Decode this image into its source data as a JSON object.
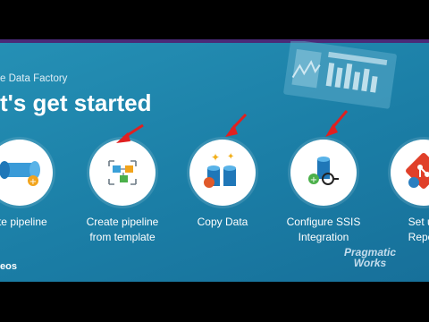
{
  "app": {
    "title": "e Data Factory",
    "headline": "t's get started"
  },
  "cards": [
    {
      "label": "ate pipeline",
      "icon": "pipeline-icon"
    },
    {
      "label": "Create pipeline\nfrom template",
      "icon": "template-icon"
    },
    {
      "label": "Copy Data",
      "icon": "copy-data-icon"
    },
    {
      "label": "Configure SSIS\nIntegration",
      "icon": "ssis-icon"
    },
    {
      "label": "Set up\nRepos",
      "icon": "git-repo-icon"
    }
  ],
  "footer": {
    "videos_label": "eos"
  },
  "watermark": {
    "line1": "Pragmatic",
    "line2": "Works"
  },
  "colors": {
    "background": "#1b7da6",
    "arrow": "#e02020",
    "accent_purple": "#4a2a78"
  }
}
